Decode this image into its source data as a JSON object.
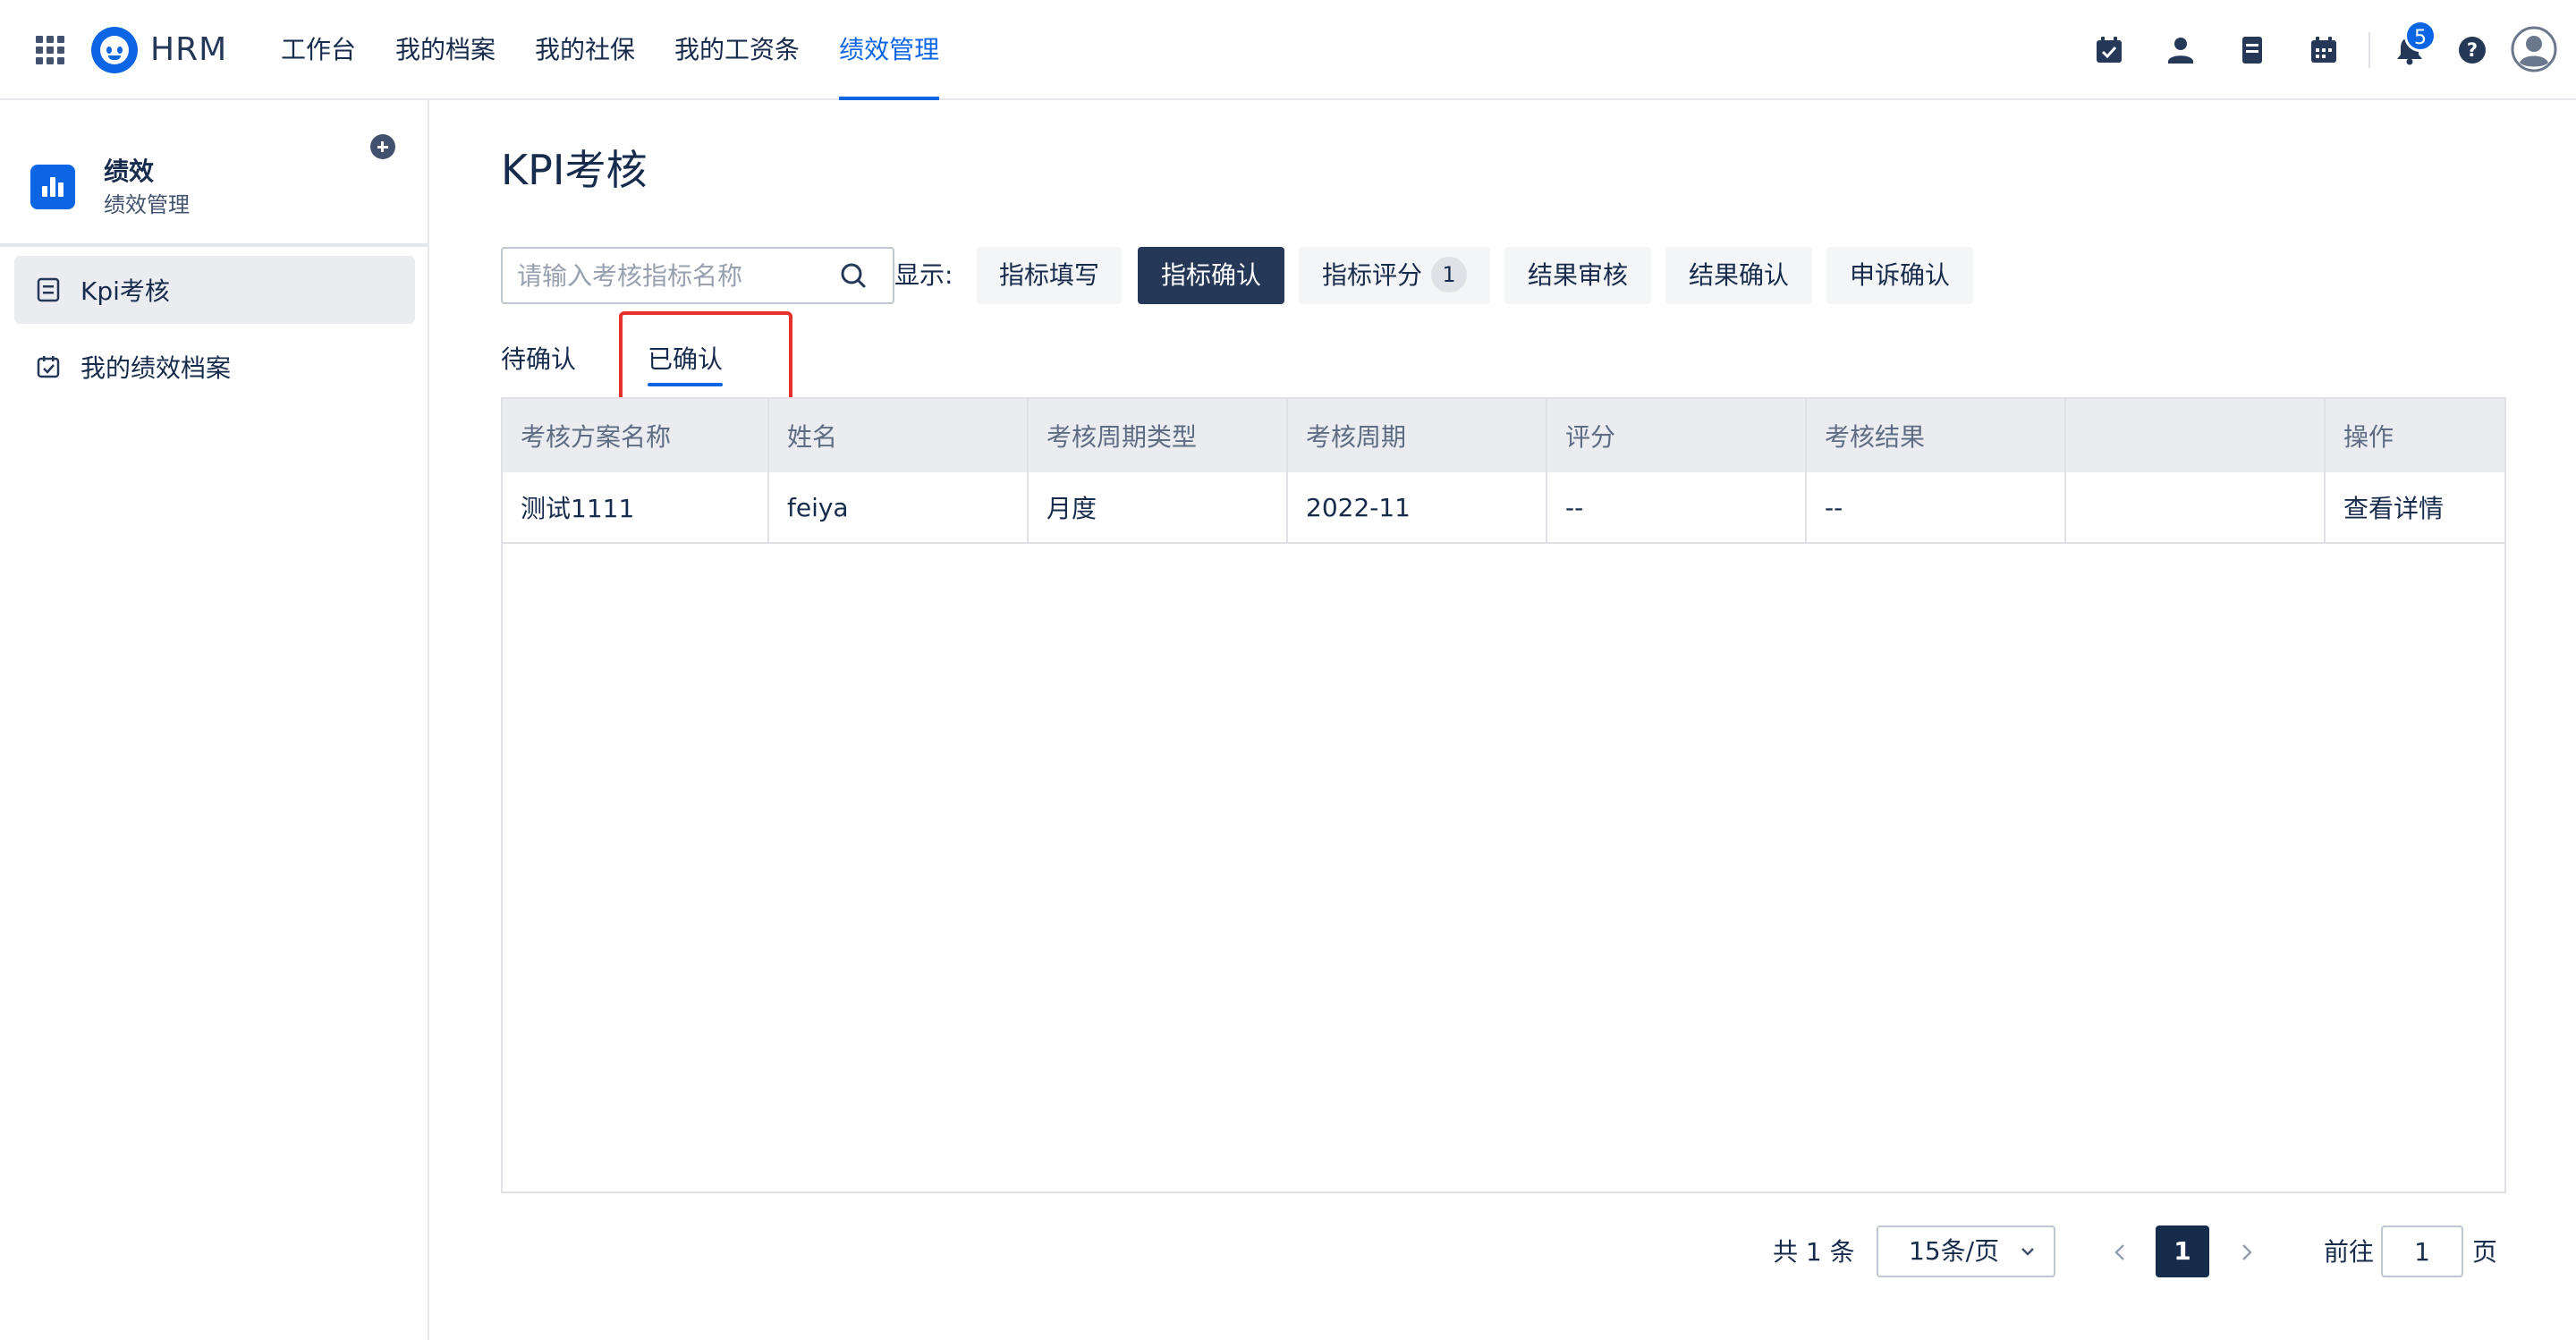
{
  "header": {
    "brand": "HRM",
    "nav": [
      {
        "label": "工作台",
        "active": false
      },
      {
        "label": "我的档案",
        "active": false
      },
      {
        "label": "我的社保",
        "active": false
      },
      {
        "label": "我的工资条",
        "active": false
      },
      {
        "label": "绩效管理",
        "active": true
      }
    ],
    "icons": [
      "calendar-check-icon",
      "user-icon",
      "document-icon",
      "calendar-icon",
      "bell-icon",
      "help-icon",
      "avatar"
    ],
    "notification_count": "5"
  },
  "sidebar": {
    "title": "绩效",
    "subtitle": "绩效管理",
    "items": [
      {
        "label": "Kpi考核",
        "active": true
      },
      {
        "label": "我的绩效档案",
        "active": false
      }
    ]
  },
  "main": {
    "title": "KPI考核",
    "search_placeholder": "请输入考核指标名称",
    "show_label": "显示:",
    "filters": [
      {
        "label": "指标填写",
        "active": false
      },
      {
        "label": "指标确认",
        "active": true
      },
      {
        "label": "指标评分",
        "active": false,
        "count": "1"
      },
      {
        "label": "结果审核",
        "active": false
      },
      {
        "label": "结果确认",
        "active": false
      },
      {
        "label": "申诉确认",
        "active": false
      }
    ],
    "tabs": [
      {
        "label": "待确认",
        "active": false
      },
      {
        "label": "已确认",
        "active": true
      }
    ],
    "table": {
      "columns": [
        "考核方案名称",
        "姓名",
        "考核周期类型",
        "考核周期",
        "评分",
        "考核结果",
        "",
        "操作"
      ],
      "rows": [
        [
          "测试1111",
          "feiya",
          "月度",
          "2022-11",
          "--",
          "--",
          "",
          "查看详情"
        ]
      ]
    },
    "pagination": {
      "total": "共 1 条",
      "page_size": "15条/页",
      "current_page": "1",
      "goto_label": "前往",
      "goto_value": "1",
      "goto_unit": "页"
    }
  },
  "colors": {
    "accent": "#0c66e4",
    "dark": "#253858",
    "highlight": "#e5302b"
  }
}
